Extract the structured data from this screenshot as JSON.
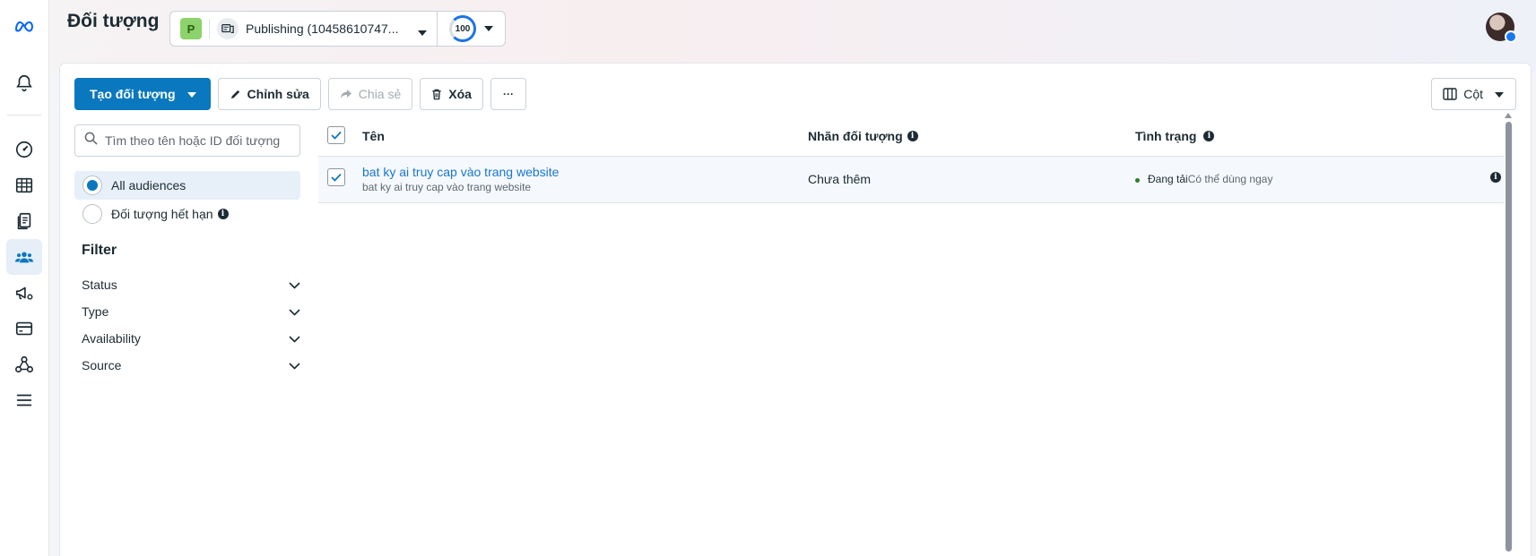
{
  "header": {
    "title": "Đối tượng",
    "account_badge": "P",
    "account_name": "Publishing (10458610747...",
    "score": "100"
  },
  "toolbar": {
    "create_label": "Tạo đối tượng",
    "edit_label": "Chỉnh sửa",
    "share_label": "Chia sẻ",
    "delete_label": "Xóa",
    "more_label": "···",
    "columns_label": "Cột"
  },
  "sidebar": {
    "search_placeholder": "Tìm theo tên hoặc ID đối tượng",
    "audience_options": [
      {
        "label": "All audiences",
        "selected": true
      },
      {
        "label": "Đối tượng hết hạn",
        "selected": false
      }
    ],
    "filter_title": "Filter",
    "filters": [
      "Status",
      "Type",
      "Availability",
      "Source"
    ]
  },
  "table": {
    "columns": [
      "Tên",
      "Nhãn đối tượng",
      "Tình trạng"
    ],
    "rows": [
      {
        "name": "bat ky ai truy cap vào trang website",
        "subtitle": "bat ky ai truy cap vào trang website",
        "label": "Chưa thêm",
        "status_primary": "Đang tải",
        "status_secondary": "Có thể dùng ngay",
        "checked": true
      }
    ]
  },
  "colors": {
    "primary": "#0a78be",
    "link": "#1876d2",
    "status_dot": "#2e7d32"
  }
}
